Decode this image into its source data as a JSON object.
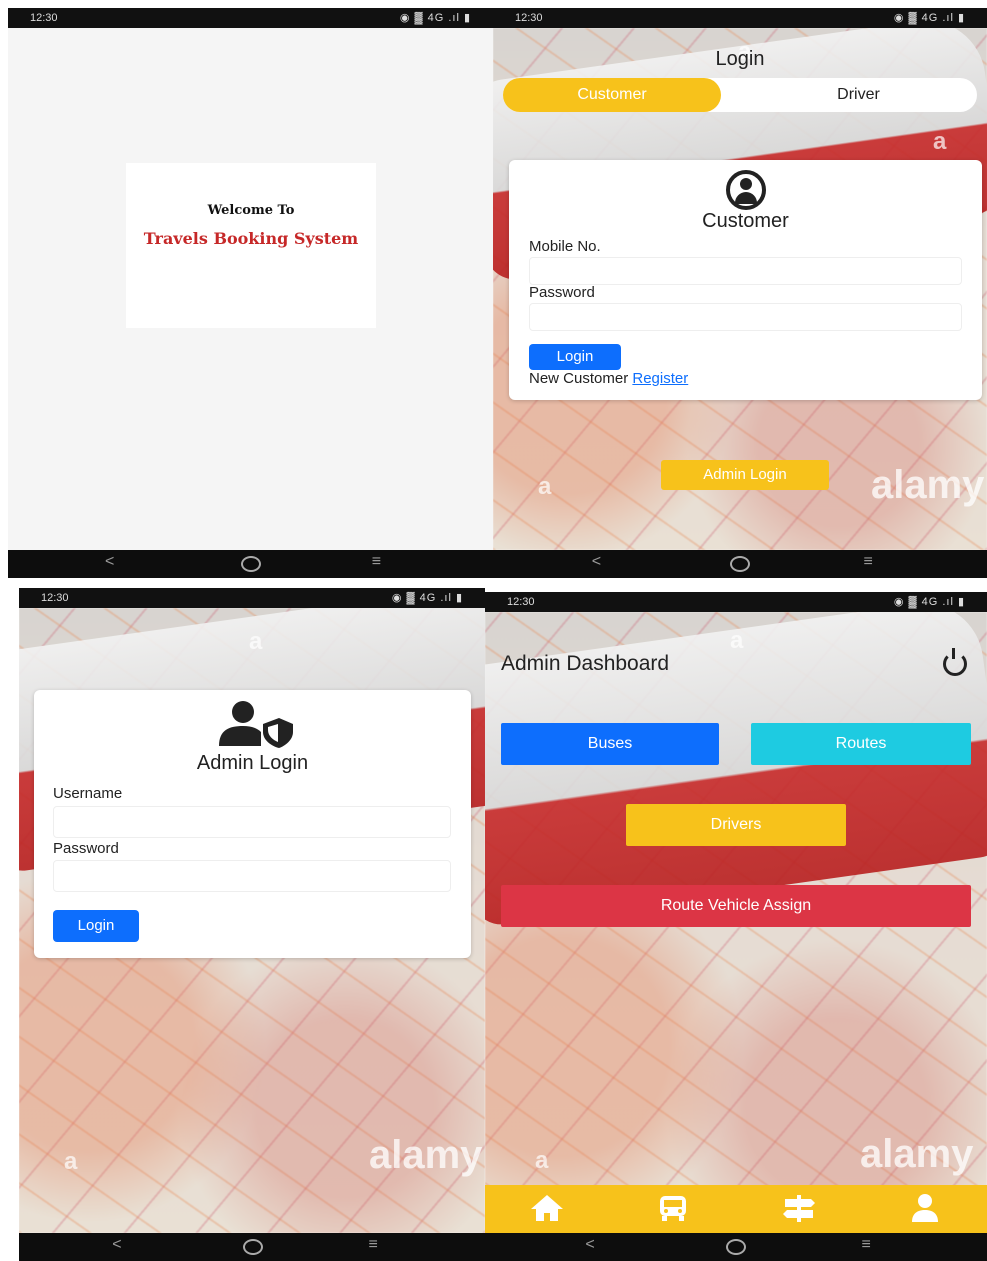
{
  "status": {
    "time": "12:30",
    "indicators": "◉ ▓ 4G .ıl ▮"
  },
  "nav": {
    "back": "<",
    "menu": "≡"
  },
  "splash": {
    "welcome": "Welcome To",
    "app_name": "Travels Booking System"
  },
  "login": {
    "title": "Login",
    "tabs": [
      "Customer",
      "Driver"
    ],
    "card_title": "Customer",
    "mobile_label": "Mobile No.",
    "password_label": "Password",
    "login_button": "Login",
    "new_customer": "New Customer",
    "register_link": "Register",
    "admin_login_button": "Admin Login"
  },
  "admin_login": {
    "title": "Admin Login",
    "username_label": "Username",
    "password_label": "Password",
    "login_button": "Login"
  },
  "dashboard": {
    "title": "Admin Dashboard",
    "buses": "Buses",
    "routes": "Routes",
    "drivers": "Drivers",
    "route_vehicle_assign": "Route Vehicle Assign"
  },
  "watermarks": {
    "a": "a",
    "alamy": "alamy"
  },
  "colors": {
    "primary": "#0d6efd",
    "yellow": "#f7c21b",
    "cyan": "#1ecbe1",
    "red": "#dc3545"
  }
}
